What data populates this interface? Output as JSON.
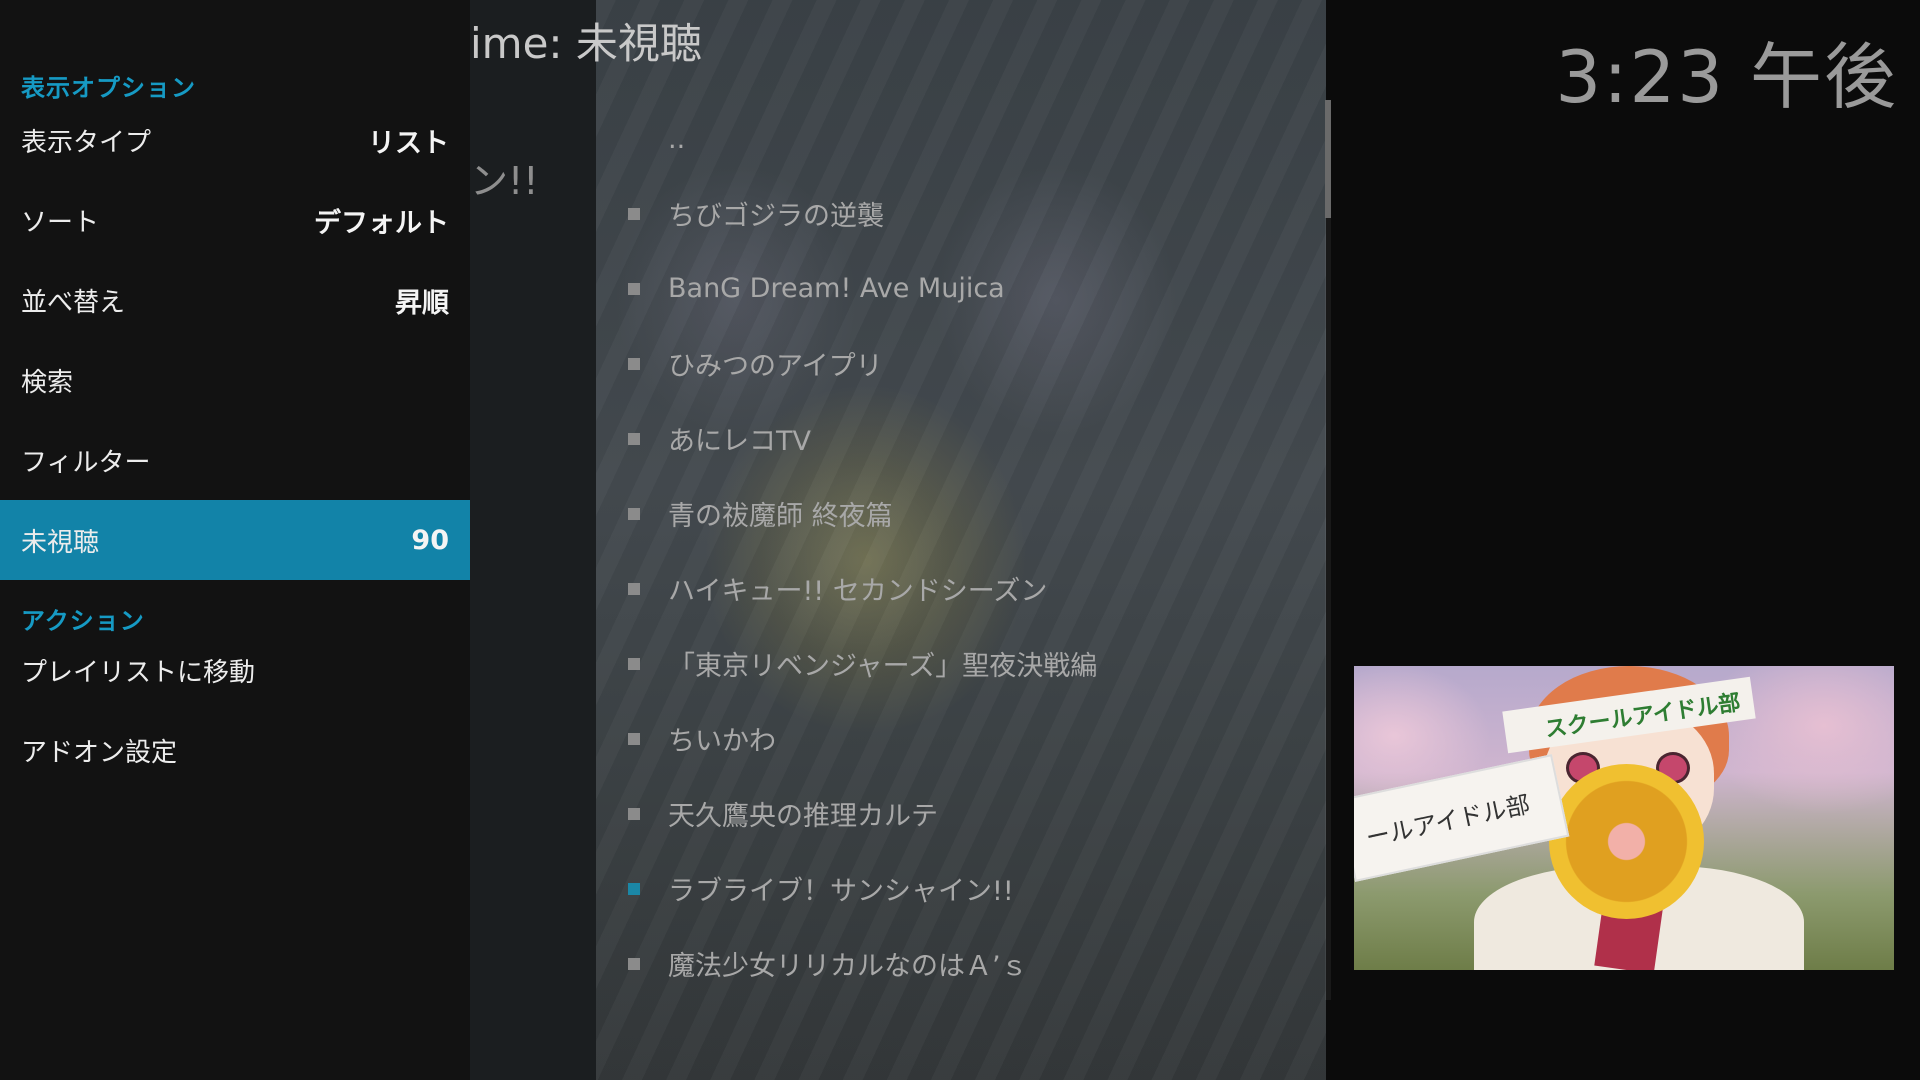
{
  "header": {
    "title": "ime: 未視聴",
    "ghost_text": "ン!!",
    "clock": "3:23 午後"
  },
  "side_panel": {
    "section_display": "表示オプション",
    "options": [
      {
        "label": "表示タイプ",
        "value": "リスト"
      },
      {
        "label": "ソート",
        "value": "デフォルト"
      },
      {
        "label": "並べ替え",
        "value": "昇順"
      },
      {
        "label": "検索",
        "value": ""
      },
      {
        "label": "フィルター",
        "value": ""
      },
      {
        "label": "未視聴",
        "value": "90",
        "selected": true
      }
    ],
    "section_action": "アクション",
    "actions": [
      {
        "label": "プレイリストに移動"
      },
      {
        "label": "アドオン設定"
      }
    ]
  },
  "list": {
    "parent": "..",
    "items": [
      "ちびゴジラの逆襲",
      "BanG Dream! Ave Mujica",
      "ひみつのアイプリ",
      "あにレコTV",
      "青の祓魔師 終夜篇",
      "ハイキュー!! セカンドシーズン",
      "「東京リベンジャーズ」聖夜決戦編",
      "ちいかわ",
      "天久鷹央の推理カルテ",
      "ラブライブ！サンシャイン!!",
      "魔法少女リリカルなのはＡ’ｓ"
    ],
    "focused_index": 9
  },
  "thumbnail": {
    "band_text": "スクールアイドル部",
    "card_text": "ールアイドル部"
  },
  "colors": {
    "accent": "#1283a8",
    "section_heading": "#169ac4",
    "focused_bullet": "#1b87a6"
  },
  "icons": {
    "list_bullet": "square-bullet-icon"
  }
}
